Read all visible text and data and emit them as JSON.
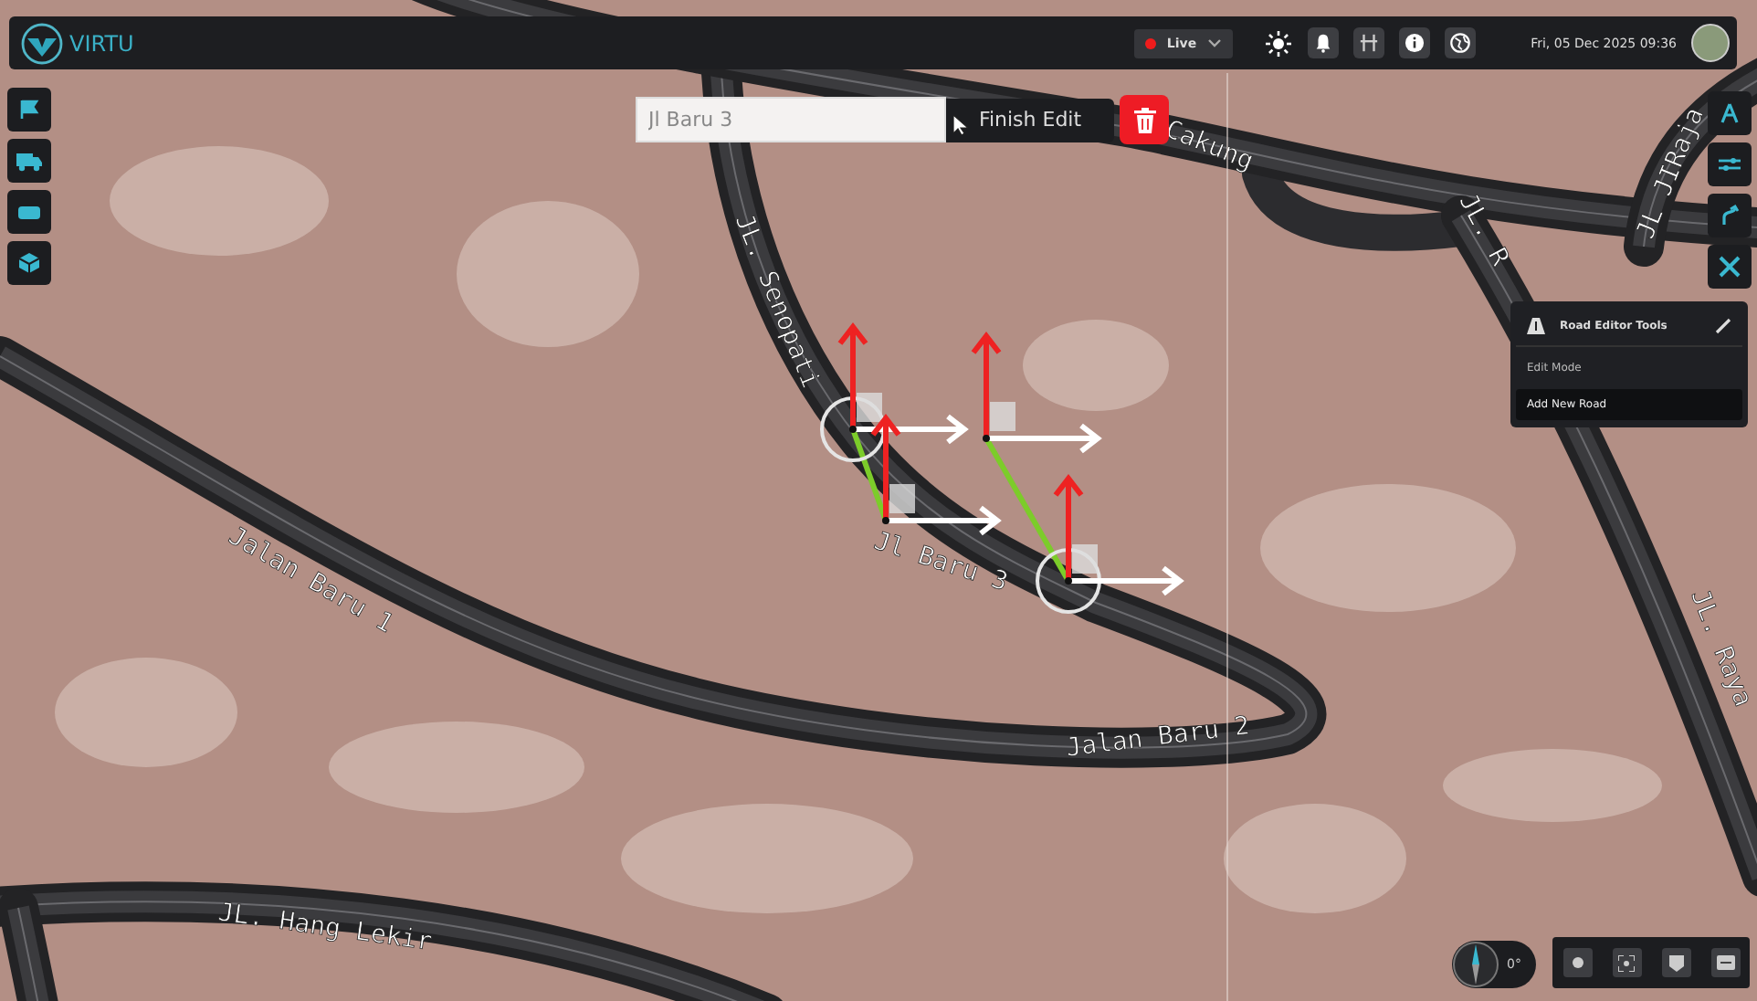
{
  "header": {
    "brand": "VIRTU",
    "live": {
      "label": "Live",
      "on": true
    },
    "datetime": "Fri, 05 Dec 2025 09:36"
  },
  "road_edit": {
    "road_name": "Jl Baru 3",
    "finish_button": "Finish Edit"
  },
  "map": {
    "road_labels": [
      "JL. Senopati",
      "Jl Baru 3",
      "Jalan Baru 1",
      "Jalan Baru 2",
      "JL. Hang Lekir",
      "Cakung",
      "JL. R",
      "JL. Raya",
      "JL JIRaja"
    ]
  },
  "road_editor": {
    "title": "Road Editor Tools",
    "items": [
      {
        "label": "Edit Mode",
        "selected": false
      },
      {
        "label": "Add New Road",
        "selected": true
      }
    ]
  },
  "compass": {
    "heading": "0°"
  }
}
